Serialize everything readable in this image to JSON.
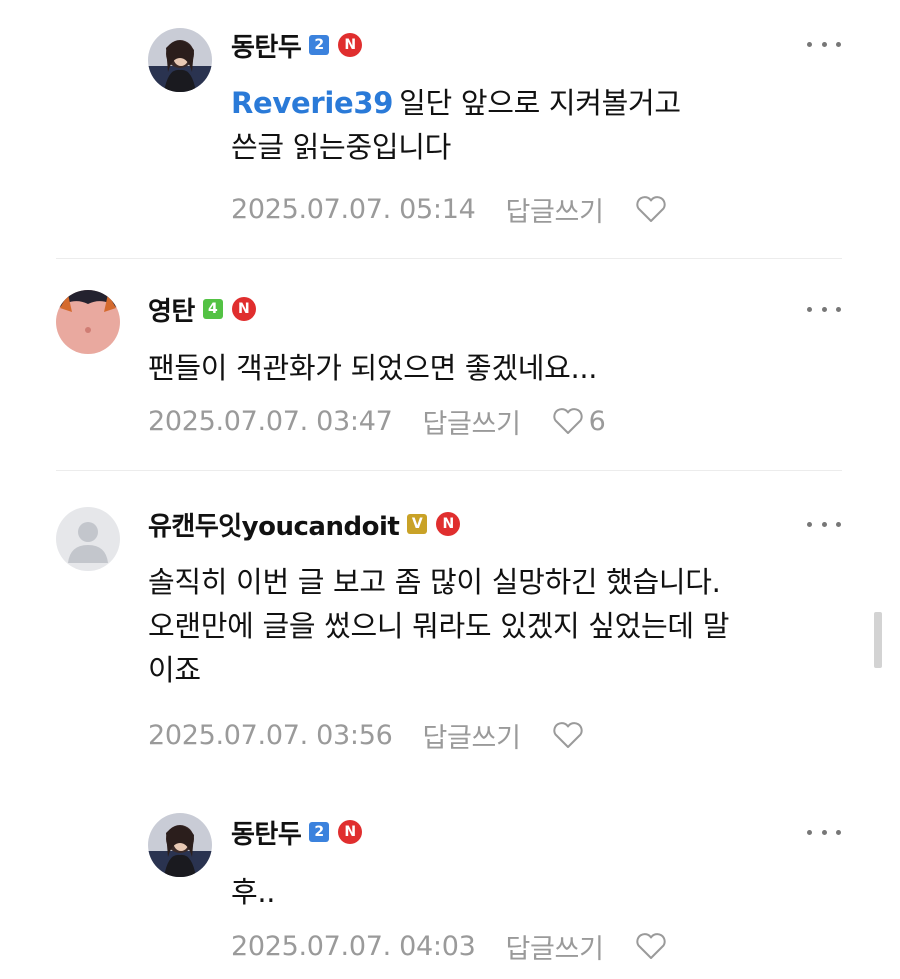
{
  "colors": {
    "mention": "#2a7ad8",
    "meta": "#9a9a9a",
    "n_badge": "#e02e2e",
    "level_blue": "#3b82dd",
    "level_green": "#53c244",
    "level_gold": "#c9a227"
  },
  "comments": [
    {
      "author": "동탄두",
      "level": "2",
      "badge": "N",
      "is_reply": true,
      "mention": "Reverie39",
      "lines": [
        "일단 앞으로 지켜볼거고",
        "쓴글 읽는중입니다"
      ],
      "date": "2025.07.07. 05:14",
      "reply_label": "답글쓰기",
      "like_count": ""
    },
    {
      "author": "영탄",
      "level": "4",
      "badge": "N",
      "is_reply": false,
      "lines": [
        "팬들이 객관화가 되었으면 좋겠네요..."
      ],
      "date": "2025.07.07. 03:47",
      "reply_label": "답글쓰기",
      "like_count": "6"
    },
    {
      "author": "유캔두잇youcandoit",
      "level": "V",
      "badge": "N",
      "is_reply": false,
      "lines": [
        "솔직히 이번 글 보고 좀 많이 실망하긴 했습니다.",
        "오랜만에 글을 썼으니 뭐라도 있겠지 싶었는데 말",
        "이죠"
      ],
      "date": "2025.07.07. 03:56",
      "reply_label": "답글쓰기",
      "like_count": ""
    },
    {
      "author": "동탄두",
      "level": "2",
      "badge": "N",
      "is_reply": true,
      "lines": [
        "후.."
      ],
      "date": "2025.07.07. 04:03",
      "reply_label": "답글쓰기",
      "like_count": ""
    }
  ]
}
